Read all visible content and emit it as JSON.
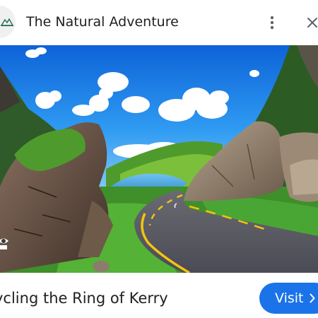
{
  "header": {
    "title": "The Natural Adventure",
    "logo_icon": "mountain-logo-icon",
    "menu_icon": "more-vert-icon",
    "close_icon": "close-icon"
  },
  "hero": {
    "subject": "Gap of Dunloe road scene",
    "colors": {
      "sky": "#1f8ff0",
      "grass": "#4caf30",
      "road": "#5a5a63",
      "road_line": "#f2c40f",
      "rock": "#7a6655"
    }
  },
  "ad": {
    "info_icon": "ad-choices-icon",
    "headline": "ycling the Ring of Kerry"
  },
  "cta": {
    "label": "Visit",
    "icon": "chevron-right-icon",
    "color": "#1a73e8"
  }
}
